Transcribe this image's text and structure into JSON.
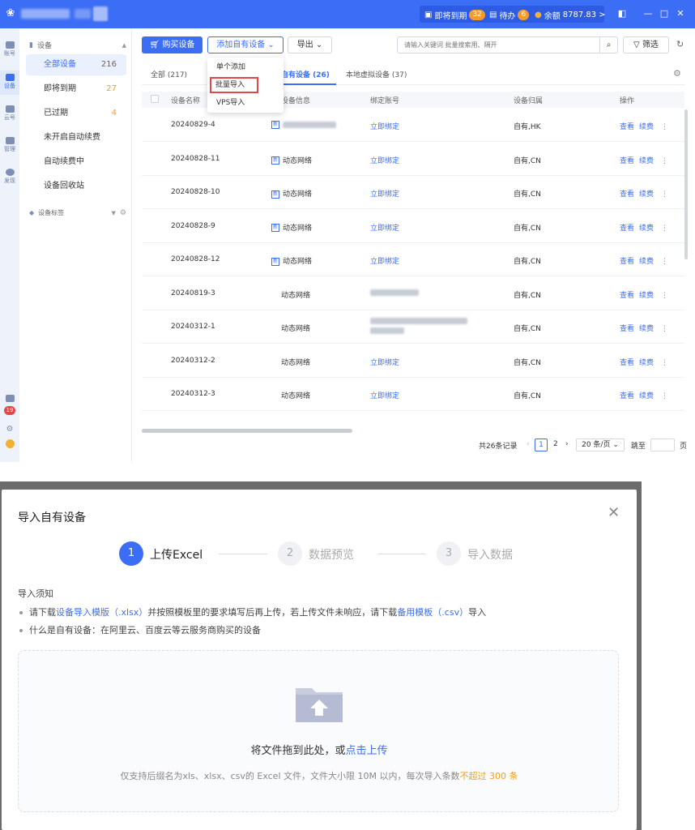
{
  "titlebar": {
    "expiring_label": "即将到期",
    "expiring_count": "32",
    "todo_label": "待办",
    "todo_count": "6",
    "balance_label": "余额",
    "balance_value": "8787.83",
    "chevron": ">"
  },
  "leftnav": {
    "items": [
      {
        "label": "账号"
      },
      {
        "label": "设备"
      },
      {
        "label": "云号"
      },
      {
        "label": "管理"
      },
      {
        "label": "发现"
      }
    ],
    "notification_count": "19"
  },
  "sidebar": {
    "section_title": "设备",
    "items": [
      {
        "label": "全部设备",
        "count": "216"
      },
      {
        "label": "即将到期",
        "count": "27"
      },
      {
        "label": "已过期",
        "count": "4"
      },
      {
        "label": "未开启自动续费",
        "count": ""
      },
      {
        "label": "自动续费中",
        "count": ""
      },
      {
        "label": "设备回收站",
        "count": ""
      }
    ],
    "tags_title": "设备标签"
  },
  "toolbar": {
    "buy_label": "购买设备",
    "add_label": "添加自有设备",
    "export_label": "导出",
    "search_placeholder": "请输入关键词 批量搜索用、隔开",
    "filter_label": "筛选"
  },
  "dropdown": {
    "items": [
      "单个添加",
      "批量导入",
      "VPS导入"
    ]
  },
  "tabs": [
    {
      "label": "全部 (217)"
    },
    {
      "label": "自有设备 (26)"
    },
    {
      "label": "本地虚拟设备 (37)"
    }
  ],
  "table": {
    "headers": [
      "设备名称",
      "设备信息",
      "绑定账号",
      "设备归属",
      "操作"
    ],
    "rows": [
      {
        "name": "20240829-4",
        "info": "",
        "bind": "立即绑定",
        "owner": "自有,HK"
      },
      {
        "name": "20240828-11",
        "info": "动态网络",
        "bind": "立即绑定",
        "owner": "自有,CN"
      },
      {
        "name": "20240828-10",
        "info": "动态网络",
        "bind": "立即绑定",
        "owner": "自有,CN"
      },
      {
        "name": "20240828-9",
        "info": "动态网络",
        "bind": "立即绑定",
        "owner": "自有,CN"
      },
      {
        "name": "20240828-12",
        "info": "动态网络",
        "bind": "立即绑定",
        "owner": "自有,CN"
      },
      {
        "name": "20240819-3",
        "info": "动态网络",
        "bind": "",
        "owner": "自有,CN"
      },
      {
        "name": "20240312-1",
        "info": "动态网络",
        "bind": "",
        "owner": "自有,CN"
      },
      {
        "name": "20240312-2",
        "info": "动态网络",
        "bind": "立即绑定",
        "owner": "自有,CN"
      },
      {
        "name": "20240312-3",
        "info": "动态网络",
        "bind": "立即绑定",
        "owner": "自有,CN"
      }
    ],
    "action_view": "查看",
    "action_renew": "续费"
  },
  "pager": {
    "total": "共26条记录",
    "page1": "1",
    "page2": "2",
    "page_size": "20 条/页",
    "goto": "跳至",
    "page_unit": "页"
  },
  "modal": {
    "title": "导入自有设备",
    "steps": [
      {
        "num": "1",
        "label": "上传Excel"
      },
      {
        "num": "2",
        "label": "数据预览"
      },
      {
        "num": "3",
        "label": "导入数据"
      }
    ],
    "notice_title": "导入须知",
    "notice1_pre": "请下载",
    "notice1_link1": "设备导入模版（.xlsx）",
    "notice1_mid": "并按照模板里的要求填写后再上传，若上传文件未响应，请下载",
    "notice1_link2": "备用模板（.csv）",
    "notice1_post": "导入",
    "notice2": "什么是自有设备：在阿里云、百度云等云服务商购买的设备",
    "drop_text": "将文件拖到此处，或",
    "drop_link": "点击上传",
    "drop_sub": "仅支持后缀名为xls、xlsx、csv的 Excel 文件，文件大小限 10M 以内，每次导入条数",
    "drop_sub_highlight": "不超过 300 条",
    "accent_color": "#3c6ef5"
  }
}
